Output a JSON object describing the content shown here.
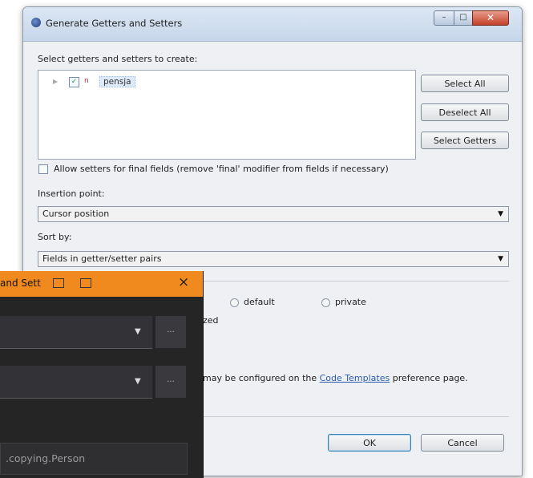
{
  "dialog": {
    "title": "Generate Getters and Setters",
    "select_label": "Select getters and setters to create:",
    "tree": {
      "field_icon": "n",
      "field_name": "pensja",
      "checked": true
    },
    "buttons": {
      "select_all": "Select All",
      "deselect_all": "Deselect All",
      "select_getters": "Select Getters"
    },
    "allow_setters_label": "Allow setters for final fields (remove 'final' modifier from fields if necessary)",
    "insertion_label": "Insertion point:",
    "insertion_value": "Cursor position",
    "sort_label": "Sort by:",
    "sort_value": "Fields in getter/setter pairs",
    "access": {
      "default": "default",
      "private": "private"
    },
    "sync_partial": "zed",
    "templates_prefix": "may be configured on the",
    "templates_link": "Code Templates",
    "templates_suffix": "preference page.",
    "ok": "OK",
    "cancel": "Cancel"
  },
  "dark_panel": {
    "title": "and Sett",
    "close": "×",
    "more_1": "...",
    "more_2": "...",
    "class_value": ".copying.Person"
  },
  "colors": {
    "accent_orange": "#f08a1e",
    "dark_bg": "#252526",
    "link": "#2a5db0"
  }
}
